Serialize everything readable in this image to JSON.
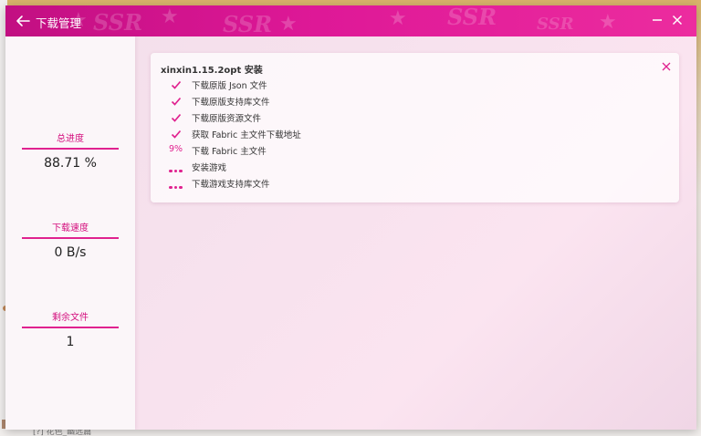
{
  "window": {
    "title": "下载管理",
    "accent": "#e0228f"
  },
  "sidebar": {
    "stats": [
      {
        "label": "总进度",
        "value": "88.71 %"
      },
      {
        "label": "下载速度",
        "value": "0 B/s"
      },
      {
        "label": "剩余文件",
        "value": "1"
      }
    ]
  },
  "task": {
    "title": "xinxin1.15.2opt 安装",
    "steps": [
      {
        "status": "done",
        "text": "下载原版 Json 文件"
      },
      {
        "status": "done",
        "text": "下载原版支持库文件"
      },
      {
        "status": "done",
        "text": "下载原版资源文件"
      },
      {
        "status": "done",
        "text": "获取 Fabric 主文件下载地址"
      },
      {
        "status": "progress",
        "progress_text": "9%",
        "text": "下载 Fabric 主文件"
      },
      {
        "status": "waiting",
        "text": "安装游戏"
      },
      {
        "status": "waiting",
        "text": "下载游戏支持库文件"
      }
    ]
  },
  "titlebar_watermark": "SSR",
  "desktop": {
    "bottom_text": "[?] 花色_幽远篇"
  }
}
